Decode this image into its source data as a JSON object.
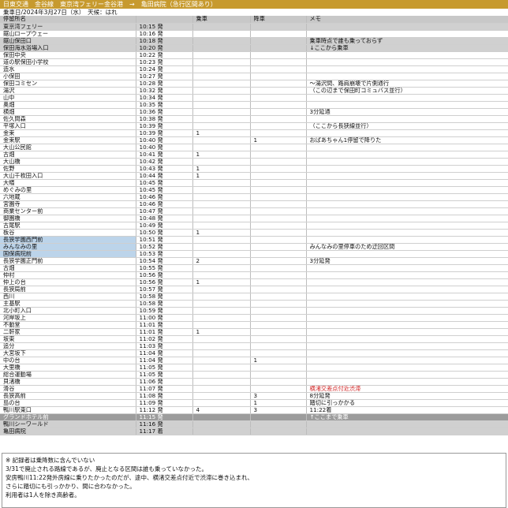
{
  "header": {
    "title": "日東交通　金谷線　東京湾フェリー金谷港　→　亀田病院（急行区間あり）",
    "subtitle": "乗車日/2024年3月27日（水）　天候：はれ"
  },
  "table": {
    "columns": [
      "停留所名",
      "",
      "乗車",
      "降車",
      "メモ"
    ],
    "rows": [
      {
        "stop": "東京湾フェリー",
        "time": "10:15 発",
        "on": "",
        "off": "",
        "memo": "",
        "hl": "light"
      },
      {
        "stop": "鋸山ロープウェー",
        "time": "10:16 発",
        "on": "",
        "off": "",
        "memo": ""
      },
      {
        "stop": "鋸山保田口",
        "time": "10:18 発",
        "on": "",
        "off": "",
        "memo": "乗車時点で誰も乗っておらず",
        "hl": "light"
      },
      {
        "stop": "保田海水浴場入口",
        "time": "10:20 発",
        "on": "",
        "off": "",
        "memo": "↓ここから乗車",
        "hl": "light"
      },
      {
        "stop": "保田中央",
        "time": "10:22 発",
        "on": "",
        "off": "",
        "memo": ""
      },
      {
        "stop": "道の駅保田小学校",
        "time": "10:23 発",
        "on": "",
        "off": "",
        "memo": ""
      },
      {
        "stop": "造水",
        "time": "10:24 発",
        "on": "",
        "off": "",
        "memo": ""
      },
      {
        "stop": "小保田",
        "time": "10:27 発",
        "on": "",
        "off": "",
        "memo": ""
      },
      {
        "stop": "保田コミセン",
        "time": "10:28 発",
        "on": "",
        "off": "",
        "memo": "～湯沢間、路肩崩壊で片側通行"
      },
      {
        "stop": "湯沢",
        "time": "10:32 発",
        "on": "",
        "off": "",
        "memo": "（この辺まで保田町コミュバス並行）"
      },
      {
        "stop": "山中",
        "time": "10:34 発",
        "on": "",
        "off": "",
        "memo": ""
      },
      {
        "stop": "奥畑",
        "time": "10:35 発",
        "on": "",
        "off": "",
        "memo": ""
      },
      {
        "stop": "横畑",
        "time": "10:36 発",
        "on": "",
        "off": "",
        "memo": "3分延通"
      },
      {
        "stop": "佐久間森",
        "time": "10:38 発",
        "on": "",
        "off": "",
        "memo": ""
      },
      {
        "stop": "平塚入口",
        "time": "10:39 発",
        "on": "",
        "off": "",
        "memo": "（ここから長狭線並行）"
      },
      {
        "stop": "金束",
        "time": "10:39 発",
        "on": "1",
        "off": "",
        "memo": ""
      },
      {
        "stop": "金束駅",
        "time": "10:40 発",
        "on": "",
        "off": "1",
        "memo": "おばあちゃん1停留で降りた"
      },
      {
        "stop": "大山公民館",
        "time": "10:40 発",
        "on": "",
        "off": "",
        "memo": ""
      },
      {
        "stop": "古畑",
        "time": "10:41 発",
        "on": "1",
        "off": "",
        "memo": ""
      },
      {
        "stop": "大山橋",
        "time": "10:42 発",
        "on": "",
        "off": "",
        "memo": ""
      },
      {
        "stop": "佐野",
        "time": "10:43 発",
        "on": "1",
        "off": "",
        "memo": ""
      },
      {
        "stop": "大山千枚田入口",
        "time": "10:44 発",
        "on": "1",
        "off": "",
        "memo": ""
      },
      {
        "stop": "大幡",
        "time": "10:45 発",
        "on": "",
        "off": "",
        "memo": ""
      },
      {
        "stop": "めぐみの里",
        "time": "10:45 発",
        "on": "",
        "off": "",
        "memo": ""
      },
      {
        "stop": "六地蔵",
        "time": "10:46 発",
        "on": "",
        "off": "",
        "memo": ""
      },
      {
        "stop": "宮園寺",
        "time": "10:46 発",
        "on": "",
        "off": "",
        "memo": ""
      },
      {
        "stop": "商業センター前",
        "time": "10:47 発",
        "on": "",
        "off": "",
        "memo": ""
      },
      {
        "stop": "御園橋",
        "time": "10:48 発",
        "on": "",
        "off": "",
        "memo": ""
      },
      {
        "stop": "古尾駅",
        "time": "10:49 発",
        "on": "",
        "off": "",
        "memo": ""
      },
      {
        "stop": "板谷",
        "time": "10:50 発",
        "on": "1",
        "off": "",
        "memo": ""
      },
      {
        "stop": "長狭学園西門前",
        "time": "10:51 発",
        "on": "",
        "off": "",
        "memo": "",
        "blue": true
      },
      {
        "stop": "みんなみの里",
        "time": "10:52 発",
        "on": "",
        "off": "",
        "memo": "みんなみの里停車のため迂回区間",
        "blue": true
      },
      {
        "stop": "国保病院前",
        "time": "10:53 発",
        "on": "",
        "off": "",
        "memo": "",
        "blue": true
      },
      {
        "stop": "長狭学園正門前",
        "time": "10:54 発",
        "on": "2",
        "off": "",
        "memo": "3分延発"
      },
      {
        "stop": "古畑",
        "time": "10:55 発",
        "on": "",
        "off": "",
        "memo": ""
      },
      {
        "stop": "仲村",
        "time": "10:56 発",
        "on": "",
        "off": "",
        "memo": ""
      },
      {
        "stop": "仲上の台",
        "time": "10:56 発",
        "on": "1",
        "off": "",
        "memo": ""
      },
      {
        "stop": "長狭局前",
        "time": "10:57 発",
        "on": "",
        "off": "",
        "memo": ""
      },
      {
        "stop": "西川",
        "time": "10:58 発",
        "on": "",
        "off": "",
        "memo": ""
      },
      {
        "stop": "主基駅",
        "time": "10:58 発",
        "on": "",
        "off": "",
        "memo": ""
      },
      {
        "stop": "北小町入口",
        "time": "10:59 発",
        "on": "",
        "off": "",
        "memo": ""
      },
      {
        "stop": "河岸坂上",
        "time": "11:00 発",
        "on": "",
        "off": "",
        "memo": ""
      },
      {
        "stop": "不動堂",
        "time": "11:01 発",
        "on": "",
        "off": "",
        "memo": ""
      },
      {
        "stop": "二軒家",
        "time": "11:01 発",
        "on": "1",
        "off": "",
        "memo": ""
      },
      {
        "stop": "坂東",
        "time": "11:02 発",
        "on": "",
        "off": "",
        "memo": ""
      },
      {
        "stop": "追分",
        "time": "11:03 発",
        "on": "",
        "off": "",
        "memo": ""
      },
      {
        "stop": "大宮坂下",
        "time": "11:04 発",
        "on": "",
        "off": "",
        "memo": ""
      },
      {
        "stop": "中の台",
        "time": "11:04 発",
        "on": "",
        "off": "1",
        "memo": ""
      },
      {
        "stop": "大里橋",
        "time": "11:05 発",
        "on": "",
        "off": "",
        "memo": ""
      },
      {
        "stop": "総合運動場",
        "time": "11:05 発",
        "on": "",
        "off": "",
        "memo": ""
      },
      {
        "stop": "貝渚橋",
        "time": "11:06 発",
        "on": "",
        "off": "",
        "memo": ""
      },
      {
        "stop": "滑谷",
        "time": "11:07 発",
        "on": "",
        "off": "",
        "memo": "横渚交差点付近渋滞",
        "red": true
      },
      {
        "stop": "長狭高前",
        "time": "11:08 発",
        "on": "",
        "off": "3",
        "memo": "8分延発"
      },
      {
        "stop": "島の台",
        "time": "11:09 発",
        "on": "",
        "off": "1",
        "memo": "踏切に引っかかる"
      },
      {
        "stop": "鴨川駅東口",
        "time": "11:12 発",
        "on": "4",
        "off": "3",
        "memo": "11:22着"
      },
      {
        "stop": "グランドホテル前",
        "time": "11:15 発",
        "on": "",
        "off": "",
        "memo": "↑ここまで乗車",
        "hl": "dark"
      },
      {
        "stop": "鴨川シーワールド",
        "time": "11:16 発",
        "on": "",
        "off": "",
        "memo": "",
        "hl": "light"
      },
      {
        "stop": "亀田病院",
        "time": "11:17 着",
        "on": "",
        "off": "",
        "memo": "",
        "hl": "light"
      }
    ]
  },
  "notes": [
    "※ 記録者は乗降数に含んでいない",
    "3/31で廃止される路線であるが、廃止となる区間は誰も乗っていなかった。",
    "安房鴨川11:22発外房線に乗りたかったのだが、途中、横渚交差点付近で渋滞に巻き込まれ、",
    "さらに踏切にも引っかかり、間に合わなかった。",
    "利用者は1人を除き高齢者。"
  ]
}
